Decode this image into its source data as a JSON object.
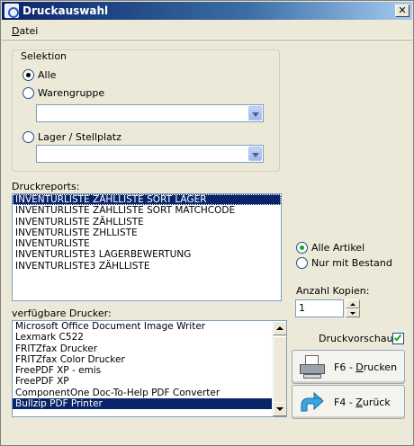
{
  "window": {
    "title": "Druckauswahl"
  },
  "menu": {
    "file_first": "D",
    "file_rest": "atei"
  },
  "selection": {
    "legend": "Selektion",
    "options": [
      "Alle",
      "Warengruppe",
      "Lager / Stellplatz"
    ],
    "selected": "Alle",
    "warengruppe_value": "",
    "lager_value": ""
  },
  "reports": {
    "label": "Druckreports:",
    "items": [
      "INVENTURLISTE ZÄHLLISTE SORT LAGER",
      "INVENTURLISTE ZÄHLLISTE SORT MATCHCODE",
      "INVENTURLISTE ZÄHLLISTE",
      "INVENTURLISTE ZHLLISTE",
      "INVENTURLISTE",
      "INVENTURLISTE3 LAGERBEWERTUNG",
      "INVENTURLISTE3 ZÄHLLISTE"
    ],
    "selected": "INVENTURLISTE ZÄHLLISTE SORT LAGER"
  },
  "article_filter": {
    "options": [
      "Alle Artikel",
      "Nur mit Bestand"
    ],
    "selected": "Alle Artikel"
  },
  "copies": {
    "label": "Anzahl Kopien:",
    "value": "1"
  },
  "printers": {
    "label": "verfügbare Drucker:",
    "items": [
      "Microsoft Office Document Image Writer",
      "Lexmark C522",
      "FRITZfax Drucker",
      "FRITZfax Color Drucker",
      "FreePDF XP - emis",
      "FreePDF XP",
      "ComponentOne Doc-To-Help PDF Converter",
      "Bullzip PDF Printer"
    ],
    "selected": "Bullzip PDF Printer"
  },
  "preview": {
    "label": "Druckvorschau:",
    "checked": true
  },
  "buttons": {
    "print": {
      "prefix": "F6 - ",
      "ul": "D",
      "rest": "rucken",
      "icon": "printer-icon"
    },
    "back": {
      "prefix": "F4 - ",
      "ul": "Z",
      "rest": "urück",
      "icon": "back-arrow-icon"
    }
  },
  "colors": {
    "title_start": "#0A246A",
    "selection_bg": "#0A246A",
    "radio_dot": "#21a121"
  }
}
